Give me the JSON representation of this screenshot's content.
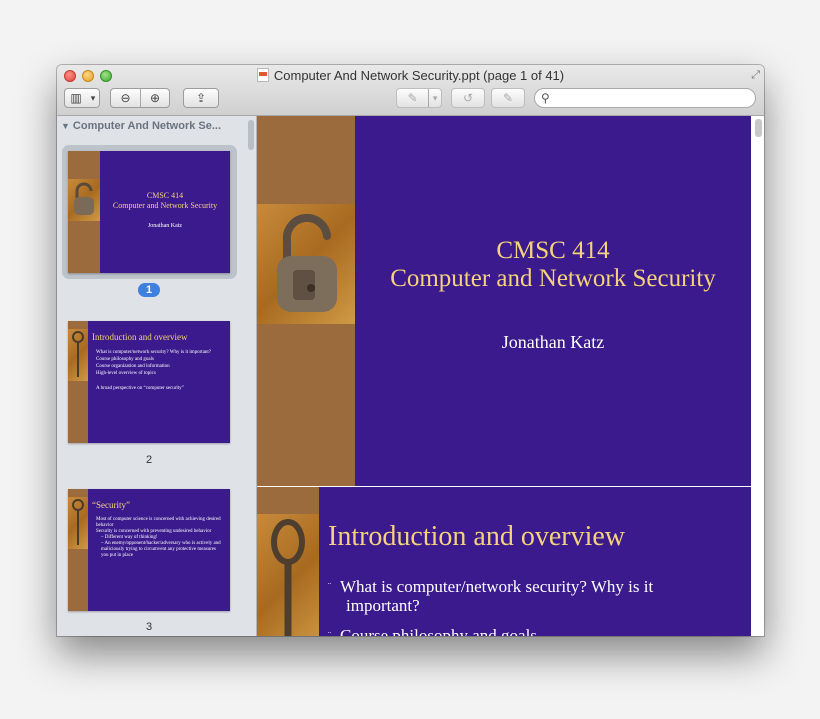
{
  "window": {
    "title": "Computer And Network Security.ppt (page 1 of 41)"
  },
  "toolbar": {
    "sidebar_toggle": "▥",
    "sidebar_menu": "▾",
    "zoom_out": "⊖",
    "zoom_in": "⊕",
    "share": "⇪",
    "annotate": "✎",
    "annotate_menu": "▾",
    "rotate": "↺",
    "edit": "✎"
  },
  "search": {
    "placeholder": "",
    "value": ""
  },
  "sidebar": {
    "header": "Computer And Network Se...",
    "pages": [
      {
        "number": "1",
        "selected": true
      },
      {
        "number": "2",
        "selected": false
      },
      {
        "number": "3",
        "selected": false
      }
    ]
  },
  "thumb1": {
    "title_line1": "CMSC 414",
    "title_line2": "Computer and Network Security",
    "author": "Jonathan Katz"
  },
  "thumb2": {
    "title": "Introduction and overview",
    "bullets": [
      "What is computer/network security? Why is it important?",
      "Course philosophy and goals",
      "Course organization and information",
      "High-level overview of topics",
      "A broad perspective on “computer security”"
    ]
  },
  "thumb3": {
    "title": "“Security”",
    "bullets": [
      "Most of computer science is concerned with achieving desired behavior",
      "Security is concerned with preventing undesired behavior",
      "– Different way of thinking!",
      "– An enemy/opponent/hacker/adversary who is actively and maliciously trying to circumvent any protective measures you put in place"
    ]
  },
  "slide1": {
    "title_line1": "CMSC 414",
    "title_line2": "Computer and Network Security",
    "author": "Jonathan Katz"
  },
  "slide2": {
    "title": "Introduction and overview",
    "bullet1_line1": "What is computer/network security? Why is it",
    "bullet1_line2": "important?",
    "bullet2": "Course philosophy and goals"
  },
  "colors": {
    "slide_bg": "#3a1a8c",
    "slide_bar": "#9b6a3d",
    "slide_title": "#f5d27d",
    "selection": "#3d80df"
  }
}
